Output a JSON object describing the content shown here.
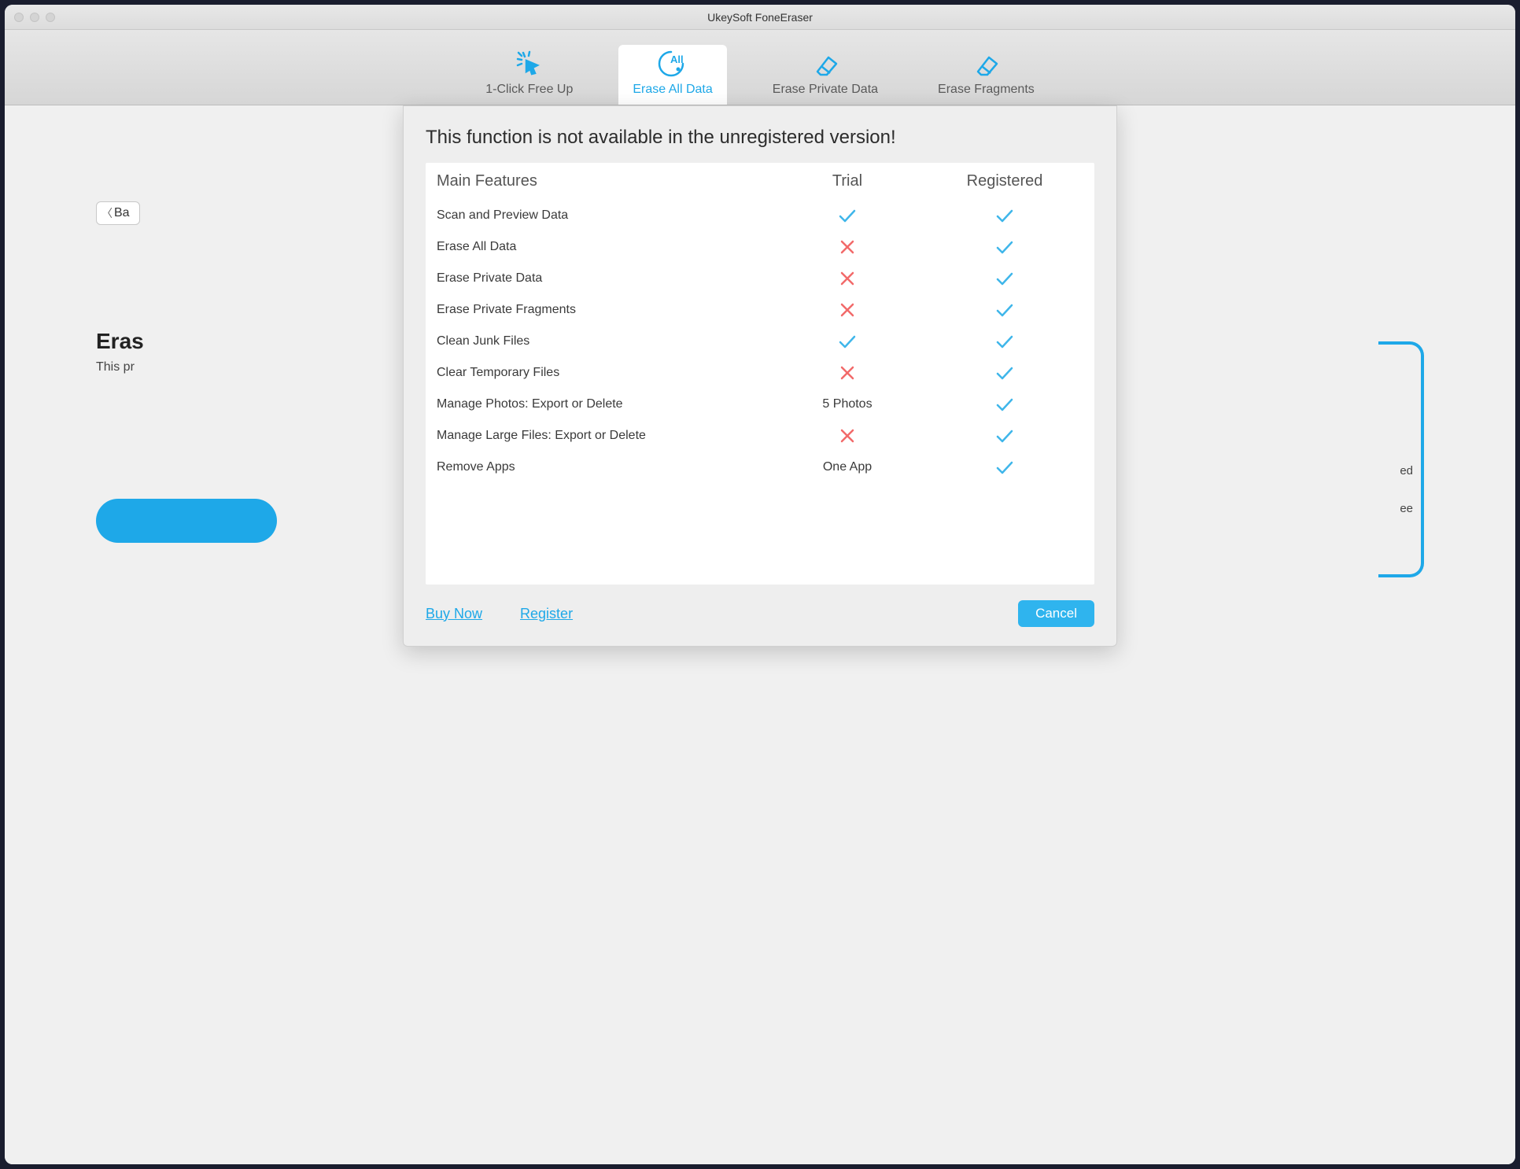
{
  "window": {
    "title": "UkeySoft FoneEraser"
  },
  "tabs": [
    {
      "label": "1-Click Free Up"
    },
    {
      "label": "Erase All Data"
    },
    {
      "label": "Erase Private Data"
    },
    {
      "label": "Erase Fragments"
    }
  ],
  "background": {
    "back_label": "Ba",
    "heading_fragment": "Eras",
    "sub_fragment": "This pr",
    "tip_line1": "ed",
    "tip_line2": "ee"
  },
  "modal": {
    "heading": "This function is not available in the unregistered version!",
    "columns": {
      "features": "Main Features",
      "trial": "Trial",
      "registered": "Registered"
    },
    "rows": [
      {
        "name": "Scan and Preview Data",
        "trial": "check",
        "registered": "check"
      },
      {
        "name": "Erase All Data",
        "trial": "cross",
        "registered": "check"
      },
      {
        "name": "Erase Private Data",
        "trial": "cross",
        "registered": "check"
      },
      {
        "name": "Erase Private Fragments",
        "trial": "cross",
        "registered": "check"
      },
      {
        "name": "Clean Junk Files",
        "trial": "check",
        "registered": "check"
      },
      {
        "name": "Clear Temporary Files",
        "trial": "cross",
        "registered": "check"
      },
      {
        "name": "Manage Photos: Export or Delete",
        "trial": "5 Photos",
        "registered": "check"
      },
      {
        "name": "Manage Large Files: Export or Delete",
        "trial": "cross",
        "registered": "check"
      },
      {
        "name": "Remove Apps",
        "trial": "One App",
        "registered": "check"
      }
    ],
    "buy_now": "Buy Now",
    "register": "Register",
    "cancel": "Cancel"
  }
}
